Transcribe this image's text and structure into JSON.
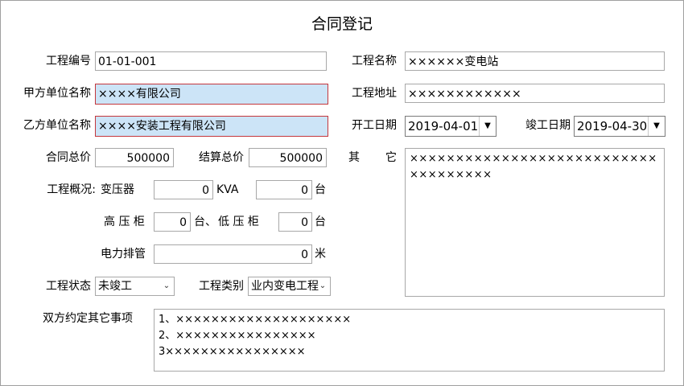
{
  "window_title": "合同登记",
  "project_no": {
    "label": "工程编号",
    "value": "01-01-001"
  },
  "project_name": {
    "label": "工程名称",
    "value": "××××××变电站"
  },
  "party_a": {
    "label": "甲方单位名称",
    "value": "××××有限公司"
  },
  "project_address": {
    "label": "工程地址",
    "value": "××××××××××××"
  },
  "party_b": {
    "label": "乙方单位名称",
    "value": "××××安装工程有限公司"
  },
  "start_date": {
    "label": "开工日期",
    "value": "2019-04-01"
  },
  "end_date": {
    "label": "竣工日期",
    "value": "2019-04-30"
  },
  "contract_total": {
    "label": "合同总价",
    "value": "500000"
  },
  "settlement_total": {
    "label": "结算总价",
    "value": "500000"
  },
  "other": {
    "label_a": "其",
    "label_b": "它",
    "value": "××××××××××××××××××××××××××××××××××××"
  },
  "overview": {
    "label": "工程概况:",
    "transformer_label": "变压器",
    "transformer_value": "0",
    "kva_unit": "KVA",
    "transformer_count": "0",
    "transformer_count_unit": "台",
    "hv_label": "高 压 柜",
    "hv_value": "0",
    "hv_unit": "台、",
    "lv_label": "低 压 柜",
    "lv_value": "0",
    "lv_unit": "台",
    "pipe_label": "电力排管",
    "pipe_value": "0",
    "pipe_unit": "米"
  },
  "status": {
    "label": "工程状态",
    "value": "未竣工"
  },
  "category": {
    "label": "工程类别",
    "value": "业内变电工程"
  },
  "agreement": {
    "label": "双方约定其它事项",
    "lines": [
      "1、××××××××××××××××××××",
      "2、××××××××××××××××",
      "3××××××××××××××××"
    ]
  }
}
